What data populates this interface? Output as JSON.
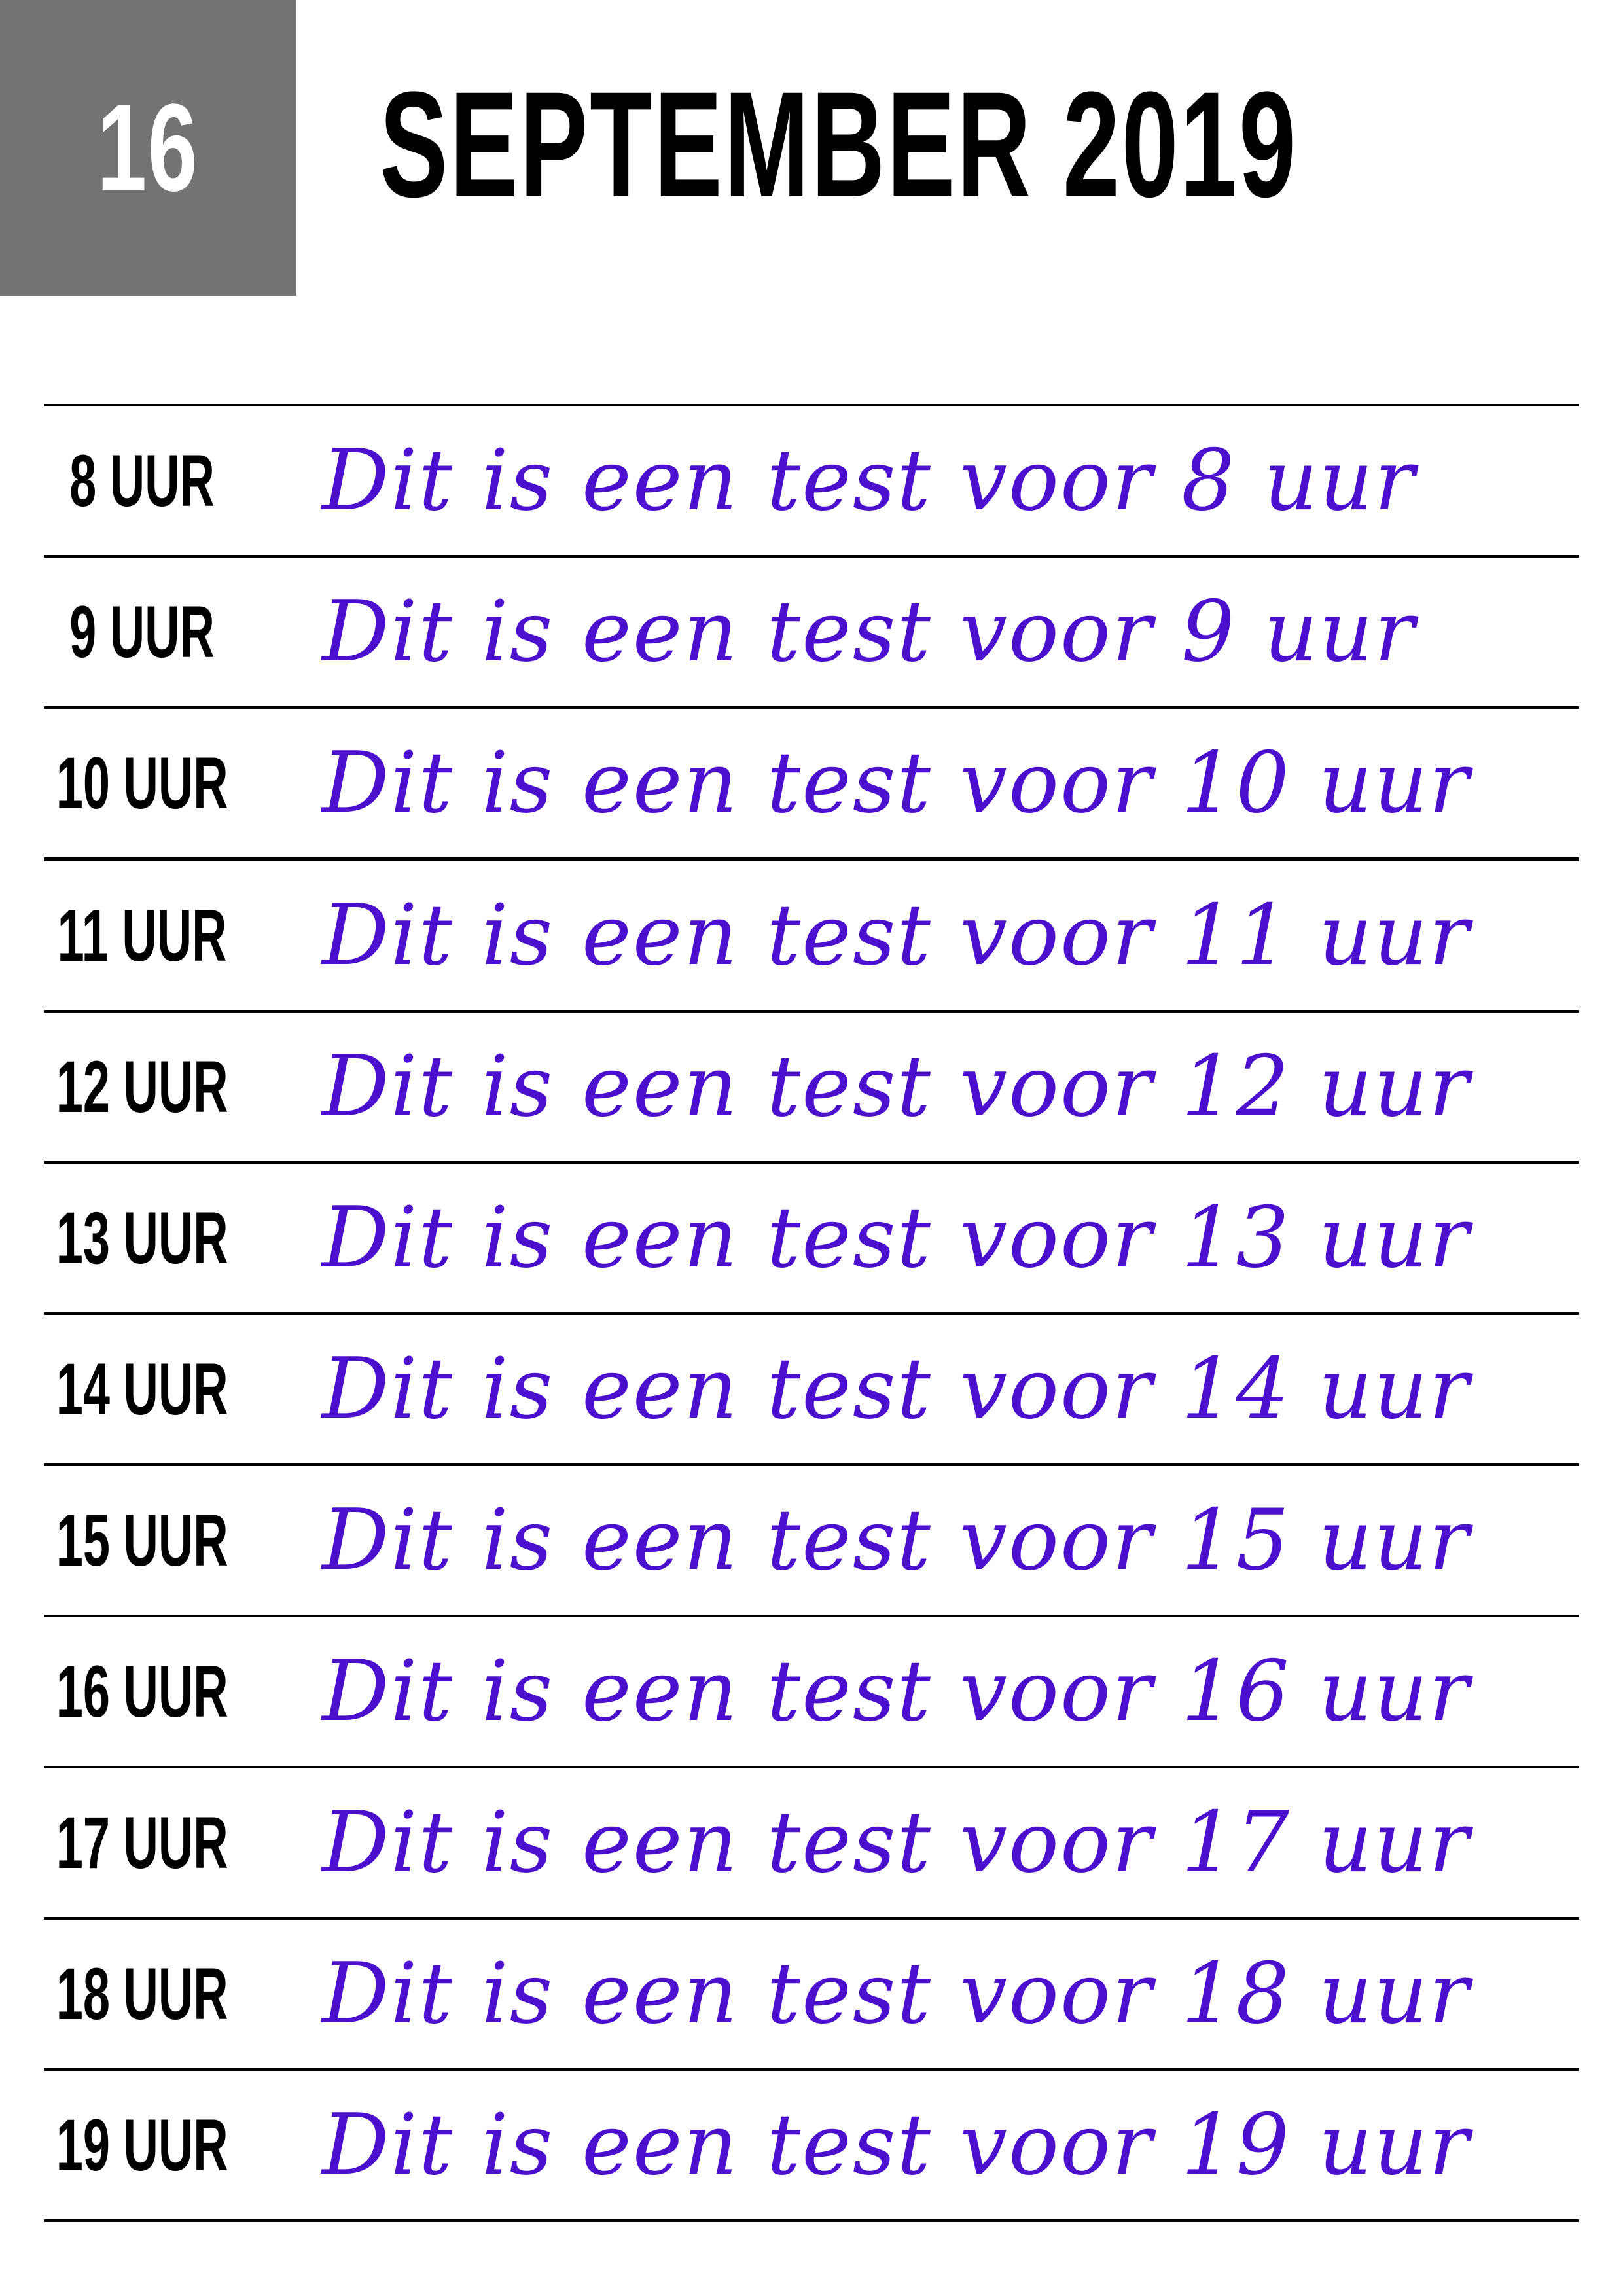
{
  "header": {
    "day": "16",
    "month_year": "SEPTEMBER 2019"
  },
  "colors": {
    "day_box": "#737373",
    "entry_text": "#4b0fce",
    "lines": "#000000"
  },
  "schedule": [
    {
      "hour": "8 UUR",
      "text": "Dit is een test voor 8 uur"
    },
    {
      "hour": "9 UUR",
      "text": "Dit is een test voor 9 uur"
    },
    {
      "hour": "10 UUR",
      "text": "Dit is een test voor 10 uur"
    },
    {
      "hour": "11 UUR",
      "text": "Dit is een test voor 11 uur"
    },
    {
      "hour": "12 UUR",
      "text": "Dit is een test voor 12 uur"
    },
    {
      "hour": "13 UUR",
      "text": "Dit is een test voor 13 uur"
    },
    {
      "hour": "14 UUR",
      "text": "Dit is een test voor 14 uur"
    },
    {
      "hour": "15 UUR",
      "text": "Dit is een test voor 15 uur"
    },
    {
      "hour": "16 UUR",
      "text": "Dit is een test voor 16 uur"
    },
    {
      "hour": "17 UUR",
      "text": "Dit is een test voor 17 uur"
    },
    {
      "hour": "18 UUR",
      "text": "Dit is een test voor 18 uur"
    },
    {
      "hour": "19 UUR",
      "text": "Dit is een test voor 19 uur"
    }
  ]
}
